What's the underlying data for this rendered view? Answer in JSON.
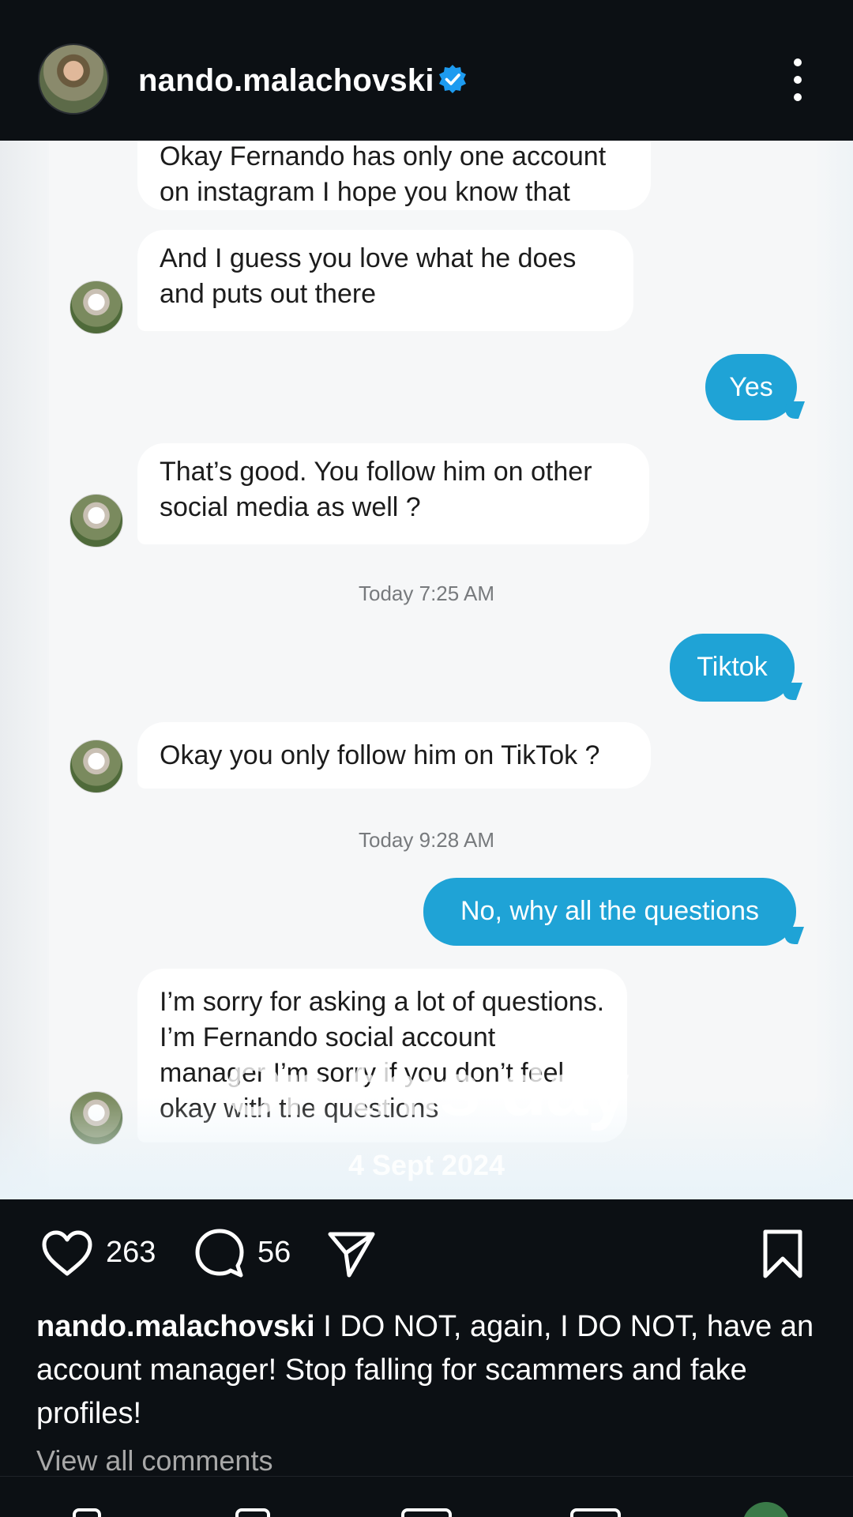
{
  "header": {
    "username": "nando.malachovski",
    "verified_icon": "verified-badge-icon",
    "more_icon": "more-vertical-icon"
  },
  "chat": {
    "messages": [
      {
        "side": "in",
        "text": "Okay Fernando has only one account on instagram I hope you know that"
      },
      {
        "side": "in",
        "text": "And I guess you love what he does and puts out there"
      },
      {
        "side": "out",
        "text": "Yes"
      },
      {
        "side": "in",
        "text": "That’s good. You follow him on other social media as well ?"
      },
      {
        "side": "time",
        "text": "Today 7:25 AM"
      },
      {
        "side": "out",
        "text": "Tiktok"
      },
      {
        "side": "in",
        "text": "Okay you only follow him on TikTok ?"
      },
      {
        "side": "time",
        "text": "Today 9:28 AM"
      },
      {
        "side": "out",
        "text": "No, why all the questions"
      },
      {
        "side": "in",
        "text": "I’m sorry for asking a lot of questions. I’m Fernando social account manager I’m sorry if you don’t feel okay with the questions"
      }
    ],
    "overlay_title": "On this day",
    "overlay_date": "4 Sept 2024"
  },
  "actions": {
    "likes": "263",
    "comments": "56",
    "like_icon": "heart-icon",
    "comment_icon": "comment-bubble-icon",
    "share_icon": "send-paper-plane-icon",
    "save_icon": "bookmark-icon"
  },
  "caption": {
    "username": "nando.malachovski",
    "text": "I DO NOT, again, I DO NOT, have an account manager! Stop falling for scammers and fake profiles!"
  },
  "view_all_comments": "View all comments",
  "colors": {
    "background": "#0c1014",
    "outgoing_bubble": "#1fa3d6",
    "verified": "#1d9bf0"
  }
}
